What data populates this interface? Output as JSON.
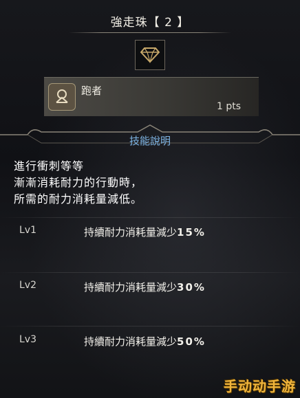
{
  "header": {
    "title": "強走珠【 2 】"
  },
  "decoration": {
    "icon": "gem-icon",
    "accent": "#c8a96a"
  },
  "skill": {
    "name": "跑者",
    "points": "1 pts",
    "icon": "runner-skill-icon"
  },
  "description": {
    "section_title": "技能說明",
    "lines": [
      "進行衝刺等等",
      "漸漸消耗耐力的行動時，",
      "所需的耐力消耗量減低。"
    ]
  },
  "levels": [
    {
      "label": "Lv1",
      "effect": "持續耐力消耗量減少",
      "value": "15%"
    },
    {
      "label": "Lv2",
      "effect": "持續耐力消耗量減少",
      "value": "30%"
    },
    {
      "label": "Lv3",
      "effect": "持續耐力消耗量減少",
      "value": "50%"
    }
  ],
  "watermark": "手动动手游"
}
